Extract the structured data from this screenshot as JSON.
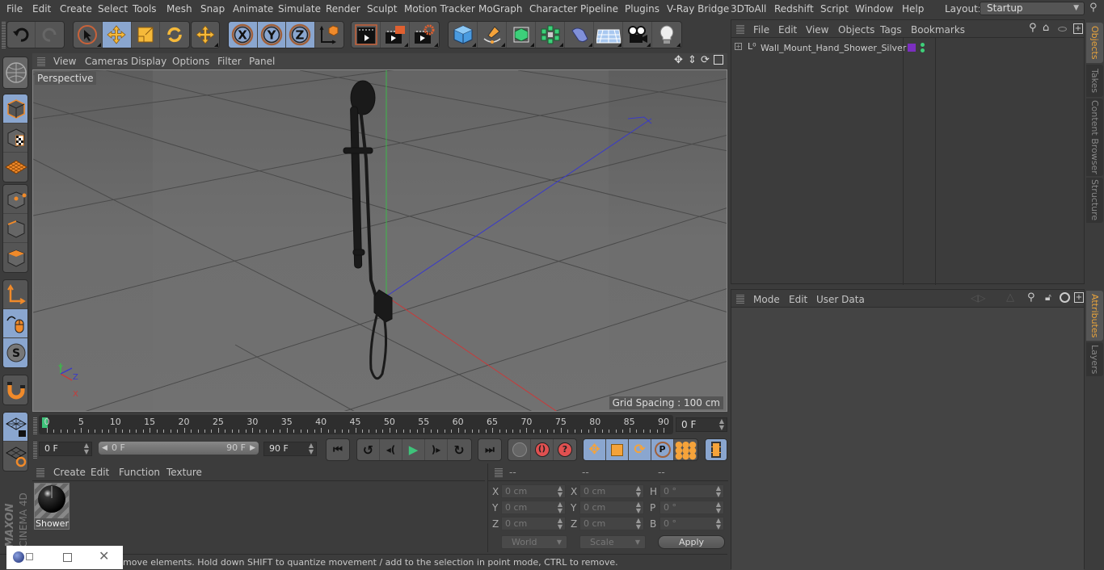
{
  "menubar": {
    "items": [
      "File",
      "Edit",
      "Create",
      "Select",
      "Tools",
      "Mesh",
      "Snap",
      "Animate",
      "Simulate",
      "Render",
      "Sculpt",
      "Motion Tracker",
      "MoGraph",
      "Character",
      "Pipeline",
      "Plugins",
      "V-Ray Bridge",
      "3DToAll",
      "Redshift",
      "Script",
      "Window",
      "Help"
    ],
    "layout_label": "Layout:",
    "layout_value": "Startup"
  },
  "toolbar": {
    "undo": "undo-icon",
    "redo": "redo-icon",
    "axis_x": "X",
    "axis_y": "Y",
    "axis_z": "Z"
  },
  "viewport": {
    "menu": [
      "View",
      "Cameras",
      "Display",
      "Options",
      "Filter",
      "Panel"
    ],
    "camera_label": "Perspective",
    "grid_spacing": "Grid Spacing : 100 cm",
    "axis_labels": {
      "x": "X",
      "y": "Y",
      "z": "Z"
    },
    "object": "Wall_Mount_Hand_Shower_Silver"
  },
  "timeline": {
    "ticks": [
      "0",
      "5",
      "10",
      "15",
      "20",
      "25",
      "30",
      "35",
      "40",
      "45",
      "50",
      "55",
      "60",
      "65",
      "70",
      "75",
      "80",
      "85",
      "90"
    ],
    "current_frame": "0 F",
    "start_field": "0 F",
    "range_start": "0 F",
    "range_end": "90 F",
    "end_field": "90 F",
    "playhead_frame": 0,
    "max_frame": 90
  },
  "material_panel": {
    "menu": [
      "Create",
      "Edit",
      "Function",
      "Texture"
    ],
    "materials": [
      {
        "name": "Shower"
      }
    ]
  },
  "coordinates": {
    "headers": [
      "--",
      "--",
      "--"
    ],
    "rows": [
      {
        "l1": "X",
        "v1": "0 cm",
        "l2": "X",
        "v2": "0 cm",
        "l3": "H",
        "v3": "0 °"
      },
      {
        "l1": "Y",
        "v1": "0 cm",
        "l2": "Y",
        "v2": "0 cm",
        "l3": "P",
        "v3": "0 °"
      },
      {
        "l1": "Z",
        "v1": "0 cm",
        "l2": "Z",
        "v2": "0 cm",
        "l3": "B",
        "v3": "0 °"
      }
    ],
    "space_select": "World",
    "mode_select": "Scale",
    "apply_label": "Apply"
  },
  "status": {
    "text": "move elements. Hold down SHIFT to quantize movement / add to the selection in point mode, CTRL to remove."
  },
  "objects_panel": {
    "menu": [
      "File",
      "Edit",
      "View",
      "Objects",
      "Tags",
      "Bookmarks"
    ],
    "items": [
      {
        "name": "Wall_Mount_Hand_Shower_Silver",
        "layer_color": "#7b2fbf"
      }
    ]
  },
  "attributes_panel": {
    "menu": [
      "Mode",
      "Edit",
      "User Data"
    ]
  },
  "side_tabs": {
    "top": [
      {
        "label": "Objects",
        "active": true
      },
      {
        "label": "Takes",
        "active": false
      },
      {
        "label": "Content Browser",
        "active": false
      },
      {
        "label": "Structure",
        "active": false
      }
    ],
    "bottom": [
      {
        "label": "Attributes",
        "active": true
      },
      {
        "label": "Layers",
        "active": false
      }
    ]
  },
  "brand": {
    "line1": "MAXON",
    "line2": "CINEMA 4D"
  },
  "colors": {
    "accent_blue": "#8aa6cf",
    "active_tab": "#e8a33c",
    "playhead": "#3ec37a",
    "axis_x": "#c83a3a",
    "axis_y": "#3cb84a",
    "axis_z": "#3a3ac8"
  }
}
